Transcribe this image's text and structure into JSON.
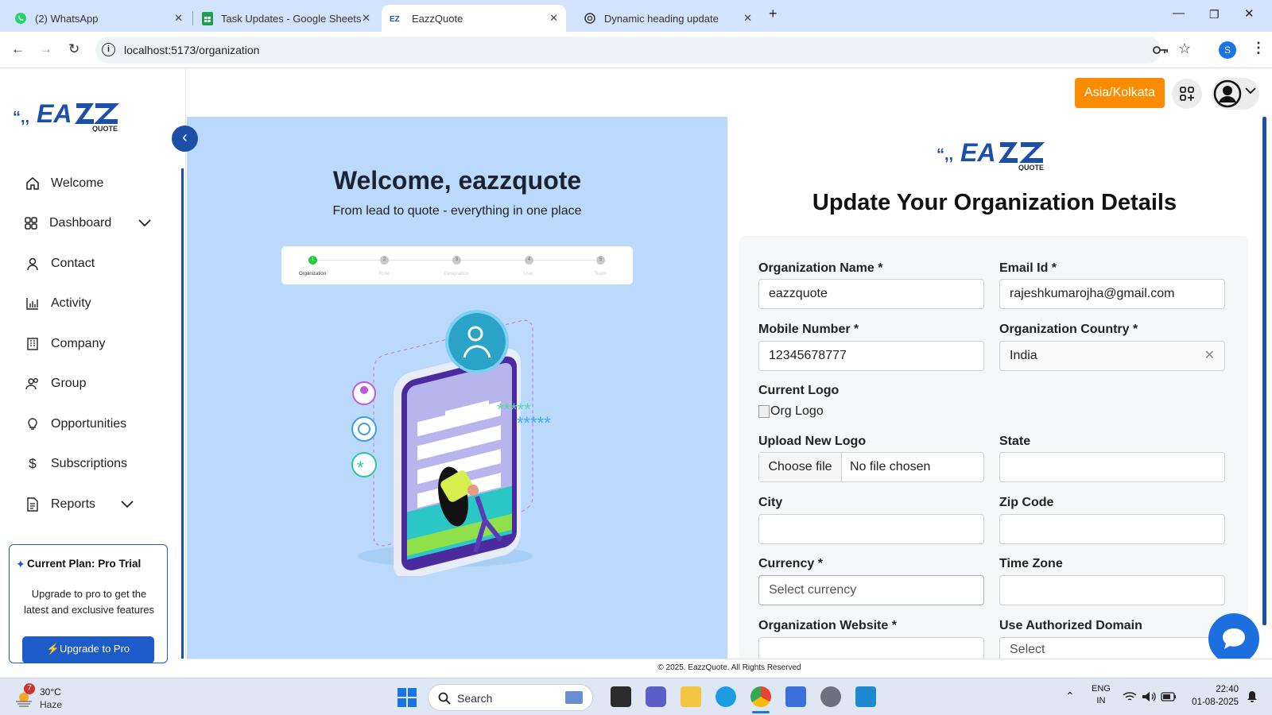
{
  "browser": {
    "tabs": [
      {
        "title": "(2) WhatsApp",
        "icon": "whatsapp-icon"
      },
      {
        "title": "Task Updates - Google Sheets",
        "icon": "sheets-icon"
      },
      {
        "title": "EazzQuote",
        "icon": "eazzquote-icon",
        "active": true
      },
      {
        "title": "Dynamic heading update",
        "icon": "chatgpt-icon"
      }
    ],
    "url": "localhost:5173/organization",
    "profile_initial": "S"
  },
  "brand": {
    "mark": "“,,EA",
    "quote": "QUOTE"
  },
  "sidebar": {
    "items": [
      {
        "label": "Welcome",
        "icon": "home-icon"
      },
      {
        "label": "Dashboard",
        "icon": "dashboard-icon",
        "expandable": true
      },
      {
        "label": "Contact",
        "icon": "user-icon"
      },
      {
        "label": "Activity",
        "icon": "bar-chart-icon"
      },
      {
        "label": "Company",
        "icon": "building-icon"
      },
      {
        "label": "Group",
        "icon": "group-icon"
      },
      {
        "label": "Opportunities",
        "icon": "lightbulb-icon"
      },
      {
        "label": "Subscriptions",
        "icon": "dollar-icon"
      },
      {
        "label": "Reports",
        "icon": "report-icon",
        "expandable": true
      }
    ],
    "plan": {
      "title": "Current Plan: Pro Trial",
      "description": "Upgrade to pro to get the latest and exclusive features",
      "button": "Upgrade to Pro"
    }
  },
  "header": {
    "timezone": "Asia/Kolkata"
  },
  "welcome": {
    "heading": "Welcome, eazzquote",
    "tagline": "From lead to quote - everything in one place",
    "steps": [
      "Organization",
      "Role",
      "Designation",
      "User",
      "Team"
    ]
  },
  "form": {
    "title": "Update Your Organization Details",
    "org_name_label": "Organization Name *",
    "org_name_value": "eazzquote",
    "email_label": "Email Id *",
    "email_value": "rajeshkumarojha@gmail.com",
    "mobile_label": "Mobile Number *",
    "mobile_value": "12345678777",
    "country_label": "Organization Country *",
    "country_value": "India",
    "current_logo_label": "Current Logo",
    "current_logo_alt": "Org Logo",
    "upload_label": "Upload New Logo",
    "choose_file": "Choose file",
    "no_file": "No file chosen",
    "state_label": "State",
    "city_label": "City",
    "zip_label": "Zip Code",
    "currency_label": "Currency *",
    "currency_placeholder": "Select currency",
    "timezone_label": "Time Zone",
    "website_label": "Organization Website *",
    "auth_domain_label": "Use Authorized Domain",
    "auth_domain_placeholder": "Select"
  },
  "footer": {
    "text": "© 2025. EazzQuote. All Rights Reserved"
  },
  "taskbar": {
    "weather_temp": "30°C",
    "weather_desc": "Haze",
    "weather_badge": "7",
    "search": "Search",
    "lang1": "ENG",
    "lang2": "IN",
    "time": "22:40",
    "date": "01-08-2025"
  },
  "colors": {
    "brand_blue": "#1d4fa8",
    "accent_orange": "#fb8c00",
    "panel_blue": "#bad9fb"
  }
}
